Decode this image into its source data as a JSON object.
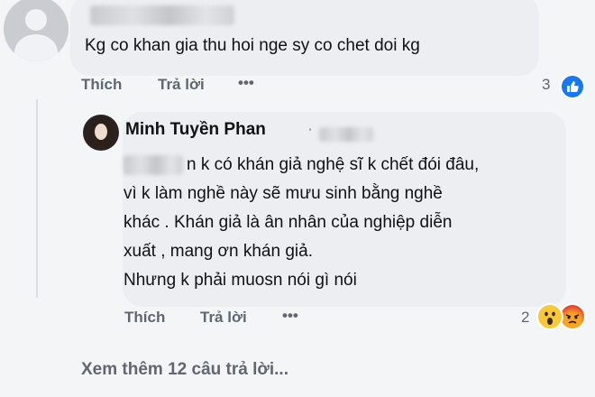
{
  "top_comment": {
    "author_name": "",
    "text": "Kg co khan gia thu hoi nge sy co chet doi kg",
    "actions": {
      "like": "Thích",
      "reply": "Trả lời",
      "more": "•••"
    },
    "reaction_count": "3",
    "reaction_icon": "like-icon"
  },
  "reply": {
    "author_name": "Minh Tuyền Phan",
    "separator": "·",
    "lines": [
      "n k có khán giả nghệ sĩ k chết đói đâu,",
      "vì k làm nghề này sẽ mưu sinh bằng nghề",
      "khác . Khán giả là ân nhân của nghiệp diễn",
      "xuất , mang ơn khán giả.",
      "Nhưng k phải muosn nói gì nói"
    ],
    "actions": {
      "like": "Thích",
      "reply": "Trả lời",
      "more": "•••"
    },
    "reaction_count": "2",
    "reaction_icons": [
      "wow-icon",
      "angry-icon"
    ]
  },
  "more_replies": {
    "label": "Xem thêm 12 câu trả lời..."
  },
  "colors": {
    "background": "#f4f5f7",
    "bubble": "#eceef1",
    "text": "#111111",
    "meta": "#606770",
    "like_blue": "#1877f2",
    "wow_yellow": "#f7c93a",
    "angry_red": "#e5452c"
  }
}
